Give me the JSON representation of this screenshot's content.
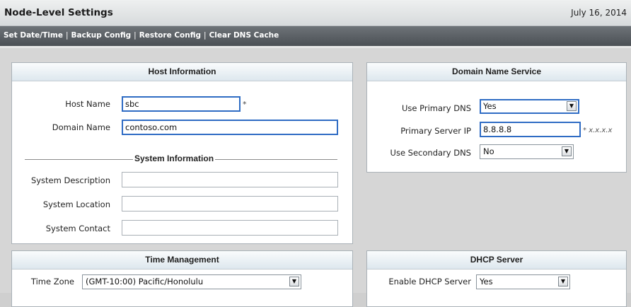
{
  "header": {
    "title": "Node-Level Settings",
    "date": "July 16, 2014"
  },
  "menu": [
    {
      "label": "Set Date/Time"
    },
    {
      "label": "Backup Config"
    },
    {
      "label": "Restore Config"
    },
    {
      "label": "Clear DNS Cache"
    }
  ],
  "menu_separator": "|",
  "host": {
    "title": "Host Information",
    "host_name": {
      "label": "Host Name",
      "value": "sbc",
      "required": "*"
    },
    "domain_name": {
      "label": "Domain Name",
      "value": "contoso.com"
    },
    "system_info_title": "System Information",
    "system_description": {
      "label": "System Description",
      "value": ""
    },
    "system_location": {
      "label": "System Location",
      "value": ""
    },
    "system_contact": {
      "label": "System Contact",
      "value": ""
    }
  },
  "dns": {
    "title": "Domain Name Service",
    "use_primary": {
      "label": "Use Primary DNS",
      "value": "Yes"
    },
    "primary_ip": {
      "label": "Primary Server IP",
      "value": "8.8.8.8",
      "hint_star": "*",
      "hint": "x.x.x.x"
    },
    "use_secondary": {
      "label": "Use Secondary DNS",
      "value": "No"
    }
  },
  "time": {
    "title": "Time Management",
    "row1_label": "Time Zone",
    "row1_value": "(GMT-10:00) Pacific/Honolulu"
  },
  "dhcp": {
    "title": "DHCP Server",
    "enable": {
      "label": "Enable DHCP Server",
      "value": "Yes"
    }
  },
  "icons": {
    "dropdown": "▼"
  }
}
